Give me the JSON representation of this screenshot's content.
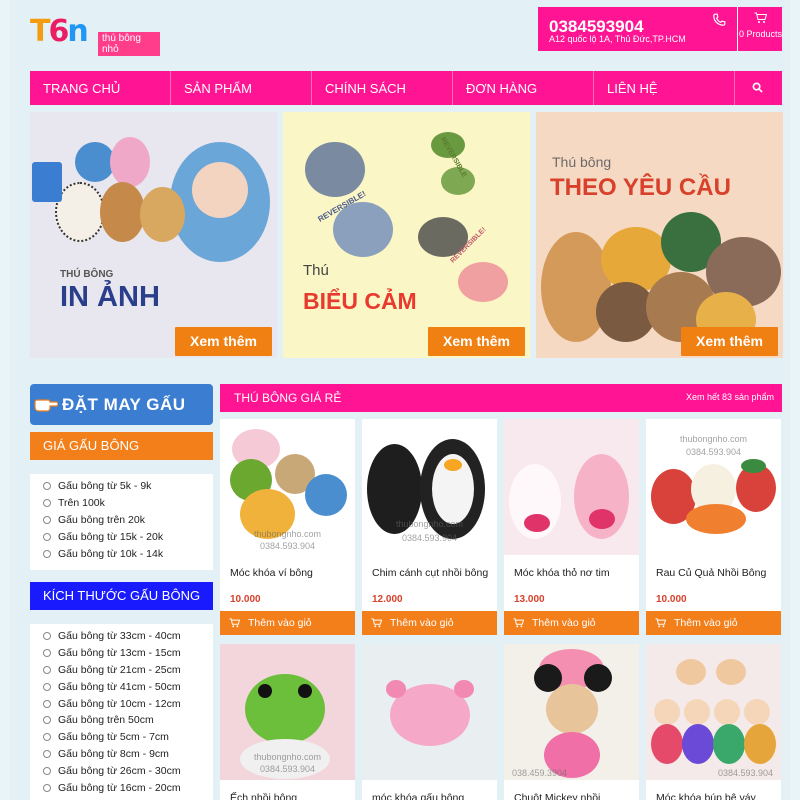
{
  "header": {
    "logo_text": "T6n",
    "logo_tagline": "thú bông nhỏ",
    "phone": "0384593904",
    "address": "A12 quốc lộ 1A, Thủ Đức,TP.HCM",
    "cart_label": "0 Products"
  },
  "nav": {
    "items": [
      "TRANG CHỦ",
      "SẢN PHẨM",
      "CHÍNH SÁCH",
      "ĐƠN HÀNG",
      "LIÊN HỆ"
    ]
  },
  "banners": [
    {
      "small": "THÚ BÔNG",
      "big": "IN ẢNH",
      "button": "Xem thêm"
    },
    {
      "small": "Thú",
      "big": "BIỂU CẢM",
      "tag1": "REVERSIBLE!",
      "tag2": "REVERSIBLE",
      "tag3": "REVERSIBLE!",
      "button": "Xem thêm"
    },
    {
      "small": "Thú bông",
      "big": "THEO YÊU CẦU",
      "button": "Xem thêm"
    }
  ],
  "sidebar": {
    "order_button": "ĐẶT MAY GẤU BÔNG",
    "price_title": "GIÁ GẤU BÔNG",
    "price_filters": [
      "Gấu bông từ 5k - 9k",
      "Trên 100k",
      "Gấu bông trên 20k",
      "Gấu bông từ 15k - 20k",
      "Gấu bông từ 10k - 14k"
    ],
    "size_title": "KÍCH THƯỚC GẤU BÔNG",
    "size_filters": [
      "Gấu bông từ 33cm - 40cm",
      "Gấu bông từ 13cm - 15cm",
      "Gấu bông từ 21cm - 25cm",
      "Gấu bông từ 41cm - 50cm",
      "Gấu bông từ 10cm - 12cm",
      "Gấu bông trên 50cm",
      "Gấu bông từ 5cm - 7cm",
      "Gấu bông từ 8cm - 9cm",
      "Gấu bông từ 26cm - 30cm",
      "Gấu bông từ 16cm - 20cm"
    ]
  },
  "section": {
    "title": "THÚ BÔNG GIÁ RẺ",
    "see_all": "Xem hết 83 sản phẩm"
  },
  "products": [
    {
      "name": "Móc khóa ví bông",
      "price": "10.000",
      "button": "Thêm vào giỏ",
      "watermark": "thubongnho.com",
      "watermark2": "0384.593.904"
    },
    {
      "name": "Chim cánh cụt nhồi bông",
      "price": "12.000",
      "button": "Thêm vào giỏ",
      "watermark": "thubongnho.com",
      "watermark2": "0384.593.904"
    },
    {
      "name": "Móc khóa thỏ nơ tim",
      "price": "13.000",
      "button": "Thêm vào giỏ",
      "watermark": "",
      "watermark2": ""
    },
    {
      "name": "Rau Củ Quả Nhồi Bông",
      "price": "10.000",
      "button": "Thêm vào giỏ",
      "watermark": "thubongnho.com",
      "watermark2": "0384.593.904"
    },
    {
      "name": "Ếch nhồi bông",
      "watermark": "thubongnho.com",
      "watermark2": "0384.593.904"
    },
    {
      "name": "móc khóa gấu bông"
    },
    {
      "name": "Chuột Mickey nhồi",
      "watermark2": "038.459.3904"
    },
    {
      "name": "Móc khóa búp bê váy",
      "watermark2": "0384.593.904"
    }
  ],
  "colors": {
    "brand_pink": "#ff1493",
    "accent_orange": "#f37f1b",
    "blue": "#1a1aff"
  }
}
